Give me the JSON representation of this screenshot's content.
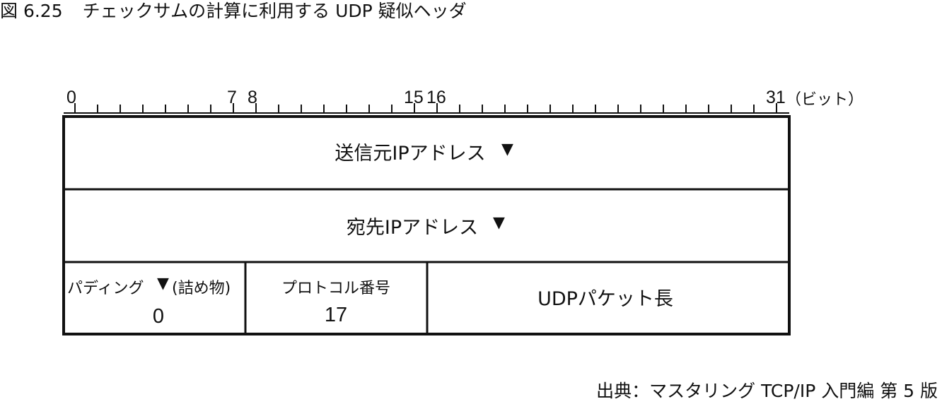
{
  "caption": {
    "figure_number": "図 6.25",
    "title": "チェックサムの計算に利用する UDP 疑似ヘッダ"
  },
  "ruler": {
    "labels": [
      "0",
      "7",
      "8",
      "15",
      "16",
      "31"
    ],
    "unit": "（ビット）"
  },
  "fields": {
    "source_ip": {
      "label": "送信元IPアドレス",
      "marker": "▼"
    },
    "dest_ip": {
      "label": "宛先IPアドレス",
      "marker": "▼"
    },
    "padding": {
      "label": "パディング",
      "marker": "▼",
      "note": "(詰め物)",
      "value": "0"
    },
    "protocol": {
      "label": "プロトコル番号",
      "value": "17"
    },
    "udp_length": {
      "label": "UDPパケット長"
    }
  },
  "source": "出典：マスタリング TCP/IP 入門編 第 5 版"
}
